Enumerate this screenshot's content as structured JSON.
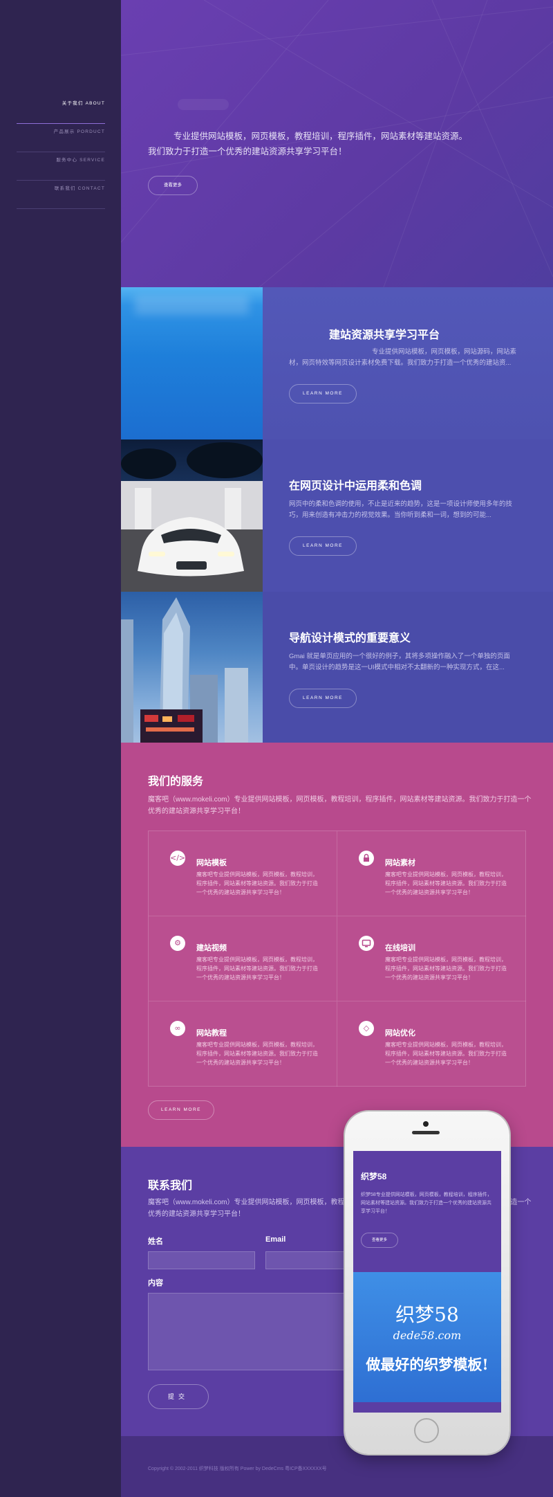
{
  "nav": {
    "items": [
      {
        "cn": "关于我们",
        "en": "ABOUT",
        "active": true
      },
      {
        "cn": "产品展示",
        "en": "PORDUCT",
        "active": false
      },
      {
        "cn": "服务中心",
        "en": "SERVICE",
        "active": false
      },
      {
        "cn": "联系我们",
        "en": "CONTACT",
        "active": false
      }
    ]
  },
  "hero": {
    "line1": "专业提供网站模板，网页模板，教程培训，程序插件，网站素材等建站资源。",
    "line2": "我们致力于打造一个优秀的建站资源共享学习平台！",
    "button": "查看更多"
  },
  "features": [
    {
      "title": "建站资源共享学习平台",
      "desc": "专业提供网站模板，网页模板，网站源码，网站素材，网页特效等网页设计素材免费下载。我们致力于打造一个优秀的建站资...",
      "button": "LEARN MORE"
    },
    {
      "title": "在网页设计中运用柔和色调",
      "desc": "网页中的柔和色调的使用，不止是近来的趋势，这是一项设计师使用多年的技巧，用来创造有冲击力的视觉效果。当你听到柔和一词，想到的可能...",
      "button": "LEARN MORE"
    },
    {
      "title": "导航设计模式的重要意义",
      "desc": "Gmai 就是单页应用的一个很好的例子，其将多项操作融入了一个单独的页面中。单页设计的趋势是这一UI模式中相对不太翻新的一种实现方式，在这...",
      "button": "LEARN MORE"
    }
  ],
  "services": {
    "title": "我们的服务",
    "intro": "魔客吧（www.mokeli.com）专业提供网站模板，网页模板，教程培训，程序插件，网站素材等建站资源。我们致力于打造一个优秀的建站资源共享学习平台！",
    "items": [
      {
        "name": "网站模板",
        "icon": "code-icon",
        "glyph": "</>",
        "desc": "魔客吧专业提供网站模板，网页模板，教程培训，程序插件，网站素材等建站资源。我们致力于打造一个优秀的建站资源共享学习平台！"
      },
      {
        "name": "网站素材",
        "icon": "lock-icon",
        "glyph": "🔒",
        "desc": "魔客吧专业提供网站模板，网页模板，教程培训，程序插件，网站素材等建站资源。我们致力于打造一个优秀的建站资源共享学习平台！"
      },
      {
        "name": "建站视频",
        "icon": "gear-icon",
        "glyph": "⚙",
        "desc": "魔客吧专业提供网站模板，网页模板，教程培训，程序插件，网站素材等建站资源。我们致力于打造一个优秀的建站资源共享学习平台！"
      },
      {
        "name": "在线培训",
        "icon": "monitor-icon",
        "glyph": "▭",
        "desc": "魔客吧专业提供网站模板，网页模板，教程培训，程序插件，网站素材等建站资源。我们致力于打造一个优秀的建站资源共享学习平台！"
      },
      {
        "name": "网站教程",
        "icon": "link-icon",
        "glyph": "∞",
        "desc": "魔客吧专业提供网站模板，网页模板，教程培训，程序插件，网站素材等建站资源。我们致力于打造一个优秀的建站资源共享学习平台！"
      },
      {
        "name": "网站优化",
        "icon": "diamond-icon",
        "glyph": "◇",
        "desc": "魔客吧专业提供网站模板，网页模板，教程培训，程序插件，网站素材等建站资源。我们致力于打造一个优秀的建站资源共享学习平台！"
      }
    ],
    "button": "LEARN MORE"
  },
  "contact": {
    "title": "联系我们",
    "intro": "魔客吧（www.mokeli.com）专业提供网站模板，网页模板，教程培训，程序插件，网站素材等建站资源。我们致力于打造一个优秀的建站资源共享学习平台！",
    "name_label": "姓名",
    "email_label": "Email",
    "content_label": "内容",
    "submit": "提交"
  },
  "footer": {
    "text": "Copyright © 2002-2011 织梦科技 版权所有 Power by DedeCms  粤ICP备XXXXXX号"
  },
  "phone": {
    "title": "织梦58",
    "text": "织梦58专业提供网站模板，网页模板，教程培训，程序插件，网站素材等建站资源。我们致力于打造一个优秀的建站资源共享学习平台！",
    "button": "查看更多",
    "logo": "织梦58",
    "domain": "dede58.com",
    "slogan": "做最好的织梦模板!"
  },
  "colors": {
    "sidebar": "#2f2450",
    "hero": "#5d3aa3",
    "features": "#5350b0",
    "services": "#b84a8d",
    "contact": "#5b3ea3"
  }
}
